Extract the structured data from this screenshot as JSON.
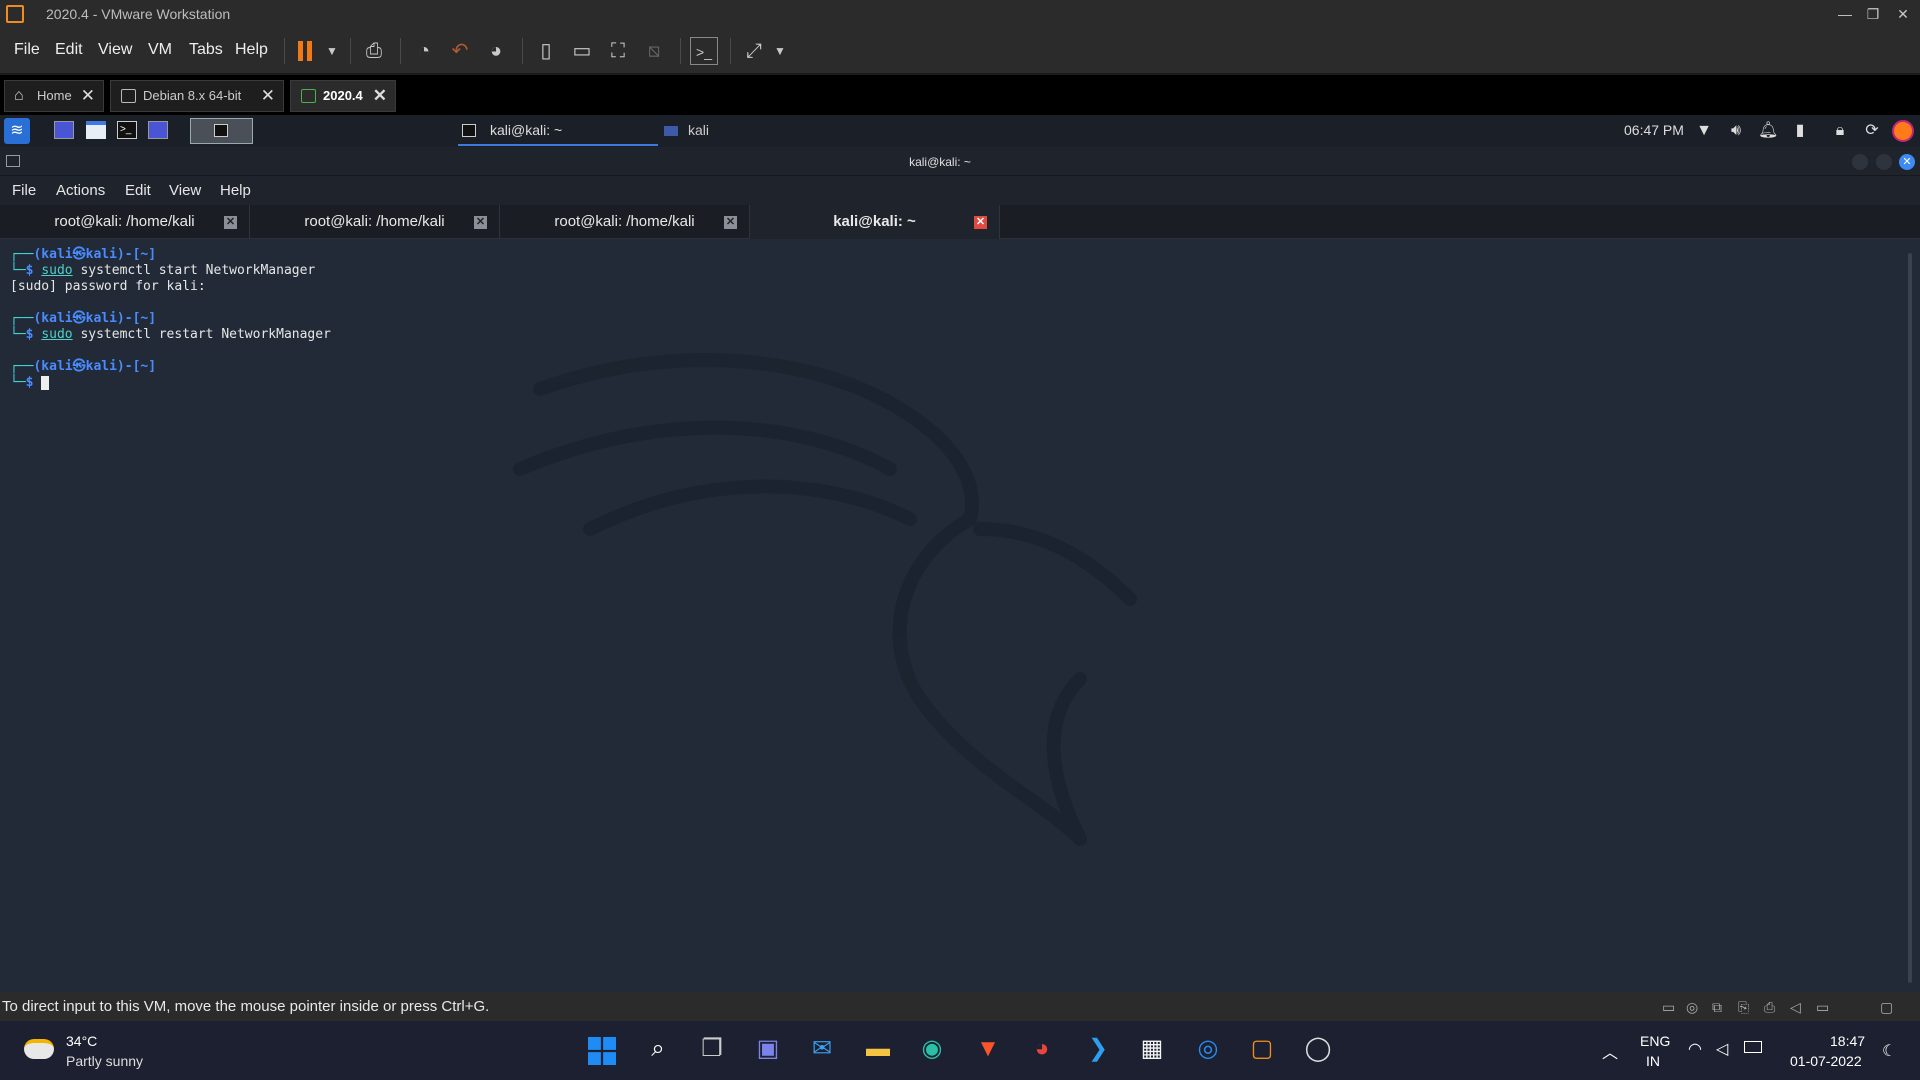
{
  "vmware": {
    "title": "2020.4 - VMware Workstation",
    "menu": [
      "File",
      "Edit",
      "View",
      "VM",
      "Tabs",
      "Help"
    ],
    "tabs": [
      {
        "label": "Home"
      },
      {
        "label": "Debian 8.x 64-bit"
      },
      {
        "label": "2020.4"
      }
    ],
    "status_text": "To direct input to this VM, move the mouse pointer inside or press Ctrl+G."
  },
  "kali_panel": {
    "task_active": "kali@kali: ~",
    "task_other": "kali",
    "clock": "06:47 PM"
  },
  "terminal": {
    "window_title": "kali@kali: ~",
    "menu": [
      "File",
      "Actions",
      "Edit",
      "View",
      "Help"
    ],
    "tabs": [
      {
        "label": "root@kali: /home/kali"
      },
      {
        "label": "root@kali: /home/kali"
      },
      {
        "label": "root@kali: /home/kali"
      },
      {
        "label": "kali@kali: ~"
      }
    ],
    "lines": {
      "p1_user": "(kali㉿kali)-[~]",
      "p1_cmd_sudo": "sudo",
      "p1_cmd_rest": " systemctl start NetworkManager",
      "out1": "[sudo] password for kali:",
      "p2_user": "(kali㉿kali)-[~]",
      "p2_cmd_sudo": "sudo",
      "p2_cmd_rest": " systemctl restart NetworkManager",
      "p3_user": "(kali㉿kali)-[~]",
      "prompt_char": "$"
    }
  },
  "taskbar": {
    "weather_temp": "34°C",
    "weather_desc": "Partly sunny",
    "lang_top": "ENG",
    "lang_bottom": "IN",
    "time": "18:47",
    "date": "01-07-2022"
  },
  "colors": {
    "vmware_chrome": "#2b2b2b",
    "terminal_bg": "#222a38",
    "prompt_cyan": "#3fd8d0",
    "prompt_blue": "#4a8cff",
    "tab_close_active": "#e04a3f",
    "taskbar_bg": "#1c2030"
  }
}
